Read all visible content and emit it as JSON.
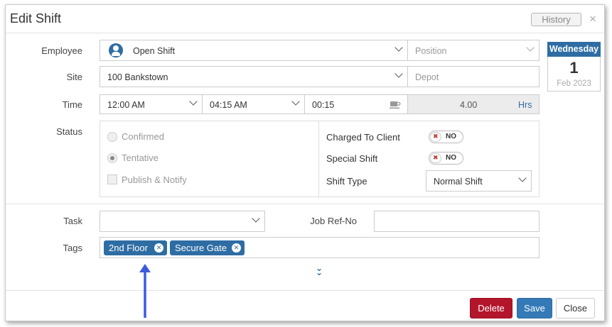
{
  "dialog": {
    "title": "Edit Shift",
    "history_label": "History",
    "close_glyph": "×"
  },
  "labels": {
    "employee": "Employee",
    "site": "Site",
    "time": "Time",
    "status": "Status",
    "task": "Task",
    "job_ref": "Job Ref-No",
    "tags": "Tags"
  },
  "employee": {
    "value": "Open Shift",
    "position_placeholder": "Position"
  },
  "site": {
    "value": "100 Bankstown",
    "depot_placeholder": "Depot"
  },
  "time": {
    "start": "12:00 AM",
    "end": "04:15 AM",
    "break": "00:15",
    "hours": "4.00",
    "hours_unit": "Hrs"
  },
  "date": {
    "weekday": "Wednesday",
    "day": "1",
    "month_year": "Feb 2023"
  },
  "status": {
    "options": [
      {
        "label": "Confirmed",
        "checked": false
      },
      {
        "label": "Tentative",
        "checked": true
      }
    ],
    "publish_label": "Publish & Notify",
    "charged_to_client": {
      "label": "Charged To Client",
      "state": "NO"
    },
    "special_shift": {
      "label": "Special Shift",
      "state": "NO"
    },
    "shift_type": {
      "label": "Shift Type",
      "value": "Normal Shift"
    }
  },
  "task": {
    "value": ""
  },
  "job_ref": {
    "value": ""
  },
  "tags": [
    {
      "label": "2nd Floor"
    },
    {
      "label": "Secure Gate"
    }
  ],
  "buttons": {
    "delete": "Delete",
    "save": "Save",
    "close": "Close"
  },
  "colors": {
    "primary": "#2e6da4",
    "danger": "#b3152a",
    "arrow": "#3b5bdb"
  }
}
